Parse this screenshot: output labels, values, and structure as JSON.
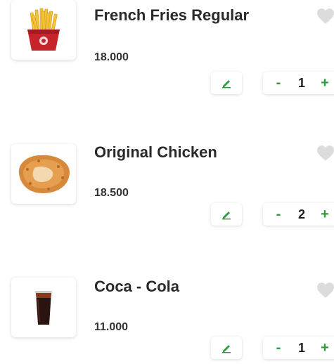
{
  "colors": {
    "accent_green": "#2e9d3e",
    "text_dark": "#2a2a2a",
    "heart_gray": "#dcdcdc"
  },
  "items": [
    {
      "name": "French Fries Regular",
      "price": "18.000",
      "quantity": "1",
      "minus_label": "-",
      "plus_label": "+",
      "image_icon": "french-fries-image",
      "favorite_icon": "heart-icon",
      "edit_icon": "pencil-icon"
    },
    {
      "name": "Original Chicken",
      "price": "18.500",
      "quantity": "2",
      "minus_label": "-",
      "plus_label": "+",
      "image_icon": "fried-chicken-image",
      "favorite_icon": "heart-icon",
      "edit_icon": "pencil-icon"
    },
    {
      "name": "Coca - Cola",
      "price": "11.000",
      "quantity": "1",
      "minus_label": "-",
      "plus_label": "+",
      "image_icon": "cola-cup-image",
      "favorite_icon": "heart-icon",
      "edit_icon": "pencil-icon"
    }
  ]
}
